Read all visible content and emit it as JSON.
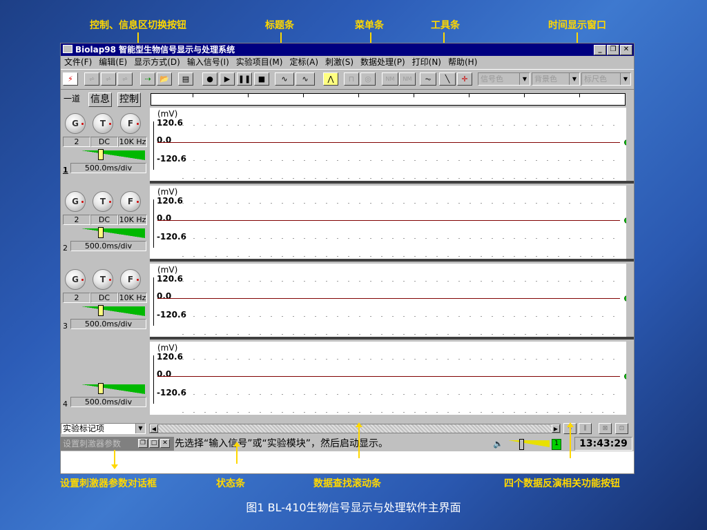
{
  "window": {
    "title": "Biolap98 智能型生物信号显示与处理系统",
    "controls": [
      "_",
      "❐",
      "✕"
    ]
  },
  "menu": [
    "文件(F)",
    "编辑(E)",
    "显示方式(D)",
    "输入信号(I)",
    "实验项目(M)",
    "定标(A)",
    "刺激(S)",
    "数据处理(P)",
    "打印(N)",
    "帮助(H)"
  ],
  "toolbar": {
    "combos": [
      "信号色",
      "背景色",
      "标尺色"
    ]
  },
  "tabs": {
    "label": "一道",
    "info": "信息",
    "control": "控制"
  },
  "channels": [
    {
      "num": "1",
      "knobs": [
        "G",
        "T",
        "F"
      ],
      "gain": "2",
      "coupling": "DC",
      "filter": "10K Hz",
      "speed": "500.0ms/div",
      "unit": "(mV)",
      "ymax": "120.6",
      "ymid": "0.0",
      "ymin": "-120.6"
    },
    {
      "num": "2",
      "knobs": [
        "G",
        "T",
        "F"
      ],
      "gain": "2",
      "coupling": "DC",
      "filter": "10K Hz",
      "speed": "500.0ms/div",
      "unit": "(mV)",
      "ymax": "120.6",
      "ymid": "0.0",
      "ymin": "-120.6"
    },
    {
      "num": "3",
      "knobs": [
        "G",
        "T",
        "F"
      ],
      "gain": "2",
      "coupling": "DC",
      "filter": "10K Hz",
      "speed": "500.0ms/div",
      "unit": "(mV)",
      "ymax": "120.6",
      "ymid": "0.0",
      "ymin": "-120.6"
    },
    {
      "num": "4",
      "speed": "500.0ms/div",
      "unit": "(mV)",
      "ymax": "120.6",
      "ymid": "0.0",
      "ymin": "-120.6"
    }
  ],
  "bottom": {
    "marker_select": "实验标记项",
    "stim_dialog": "设置刺激器参数",
    "status_text": "先选择“输入信号”或“实验模块”，然后启动显示。",
    "volume_value": "1",
    "clock": "13:43:29"
  },
  "callouts": {
    "switch": "控制、信息区切换按钮",
    "titlebar": "标题条",
    "menubar": "菜单条",
    "toolbar": "工具条",
    "time_window": "时间显示窗口",
    "stim_dialog": "设置刺激器参数对话框",
    "statusbar": "状态条",
    "scrollbar": "数据查找滚动条",
    "buttons": "四个数据反演相关功能按钮"
  },
  "caption": "图1   BL-410生物信号显示与处理软件主界面"
}
